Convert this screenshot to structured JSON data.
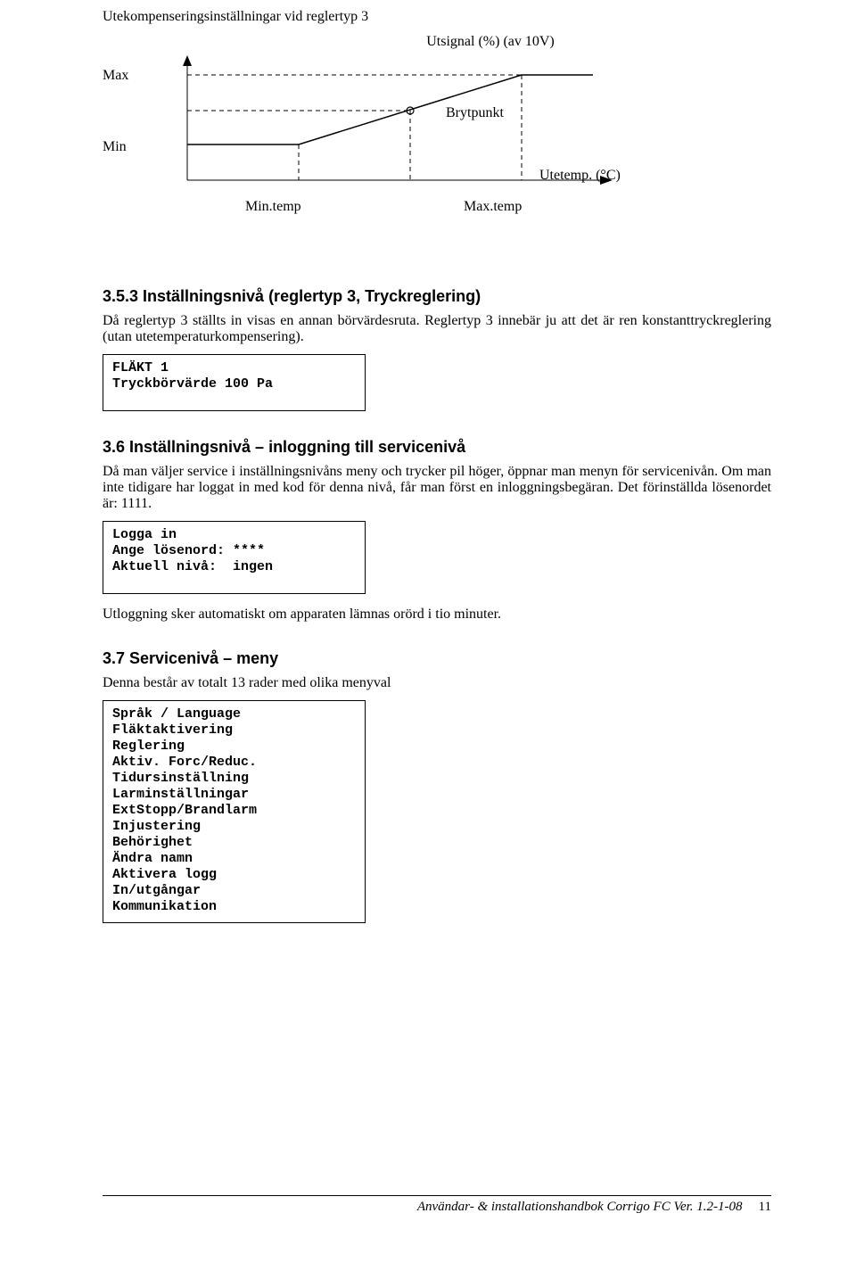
{
  "intro_line": "Utekompenseringsinställningar vid reglertyp 3",
  "chart": {
    "title": "Utsignal (%)  (av 10V)",
    "y_max": "Max",
    "y_min": "Min",
    "label_brytpunkt": "Brytpunkt",
    "label_utetemp": "Utetemp. (°C)",
    "x_min": "Min.temp",
    "x_max": "Max.temp"
  },
  "chart_data": {
    "type": "line",
    "title": "Utsignal (%) (av 10V)",
    "xlabel": "Utetemp. (°C)",
    "ylabel": "Utsignal (%)",
    "x_ticks": [
      "Min.temp",
      "Max.temp"
    ],
    "y_ticks": [
      "Min",
      "Max"
    ],
    "description": "Piecewise-linear output: at Min level until Min.temp, then rises linearly to Max level at Max.temp, then flat at Max. A breakpoint (Brytpunkt) marker sits mid-ramp."
  },
  "sec35": {
    "heading": "3.5.3 Inställningsnivå (reglertyp 3, Tryckreglering)",
    "p1": "Då reglertyp 3 ställts in visas en annan börvärdesruta. Reglertyp 3 innebär ju att det är ren konstanttryckreglering (utan utetemperaturkompensering).",
    "box": "FLÄKT 1\nTryckbörvärde 100 Pa"
  },
  "sec36": {
    "heading": "3.6  Inställningsnivå – inloggning till servicenivå",
    "p1": "Då man väljer service i inställningsnivåns meny och trycker pil höger, öppnar man menyn för servicenivån. Om man inte tidigare har loggat in med kod för denna nivå, får man först en inloggningsbegäran. Det förinställda lösenordet är: 1111.",
    "box": "Logga in\nAnge lösenord: ****\nAktuell nivå:  ingen",
    "p2": "Utloggning sker automatiskt om apparaten lämnas orörd i tio minuter."
  },
  "sec37": {
    "heading": "3.7  Servicenivå – meny",
    "p1": "Denna består av totalt 13 rader med olika menyval",
    "menu": [
      "Språk / Language",
      "Fläktaktivering",
      "Reglering",
      "Aktiv. Forc/Reduc.",
      "Tidursinställning",
      "Larminställningar",
      "ExtStopp/Brandlarm",
      "Injustering",
      "Behörighet",
      "Ändra namn",
      "Aktivera logg",
      "In/utgångar",
      "Kommunikation"
    ]
  },
  "footer": {
    "title": "Användar- & installationshandbok Corrigo FC Ver. 1.2-1-08",
    "page": "11"
  }
}
